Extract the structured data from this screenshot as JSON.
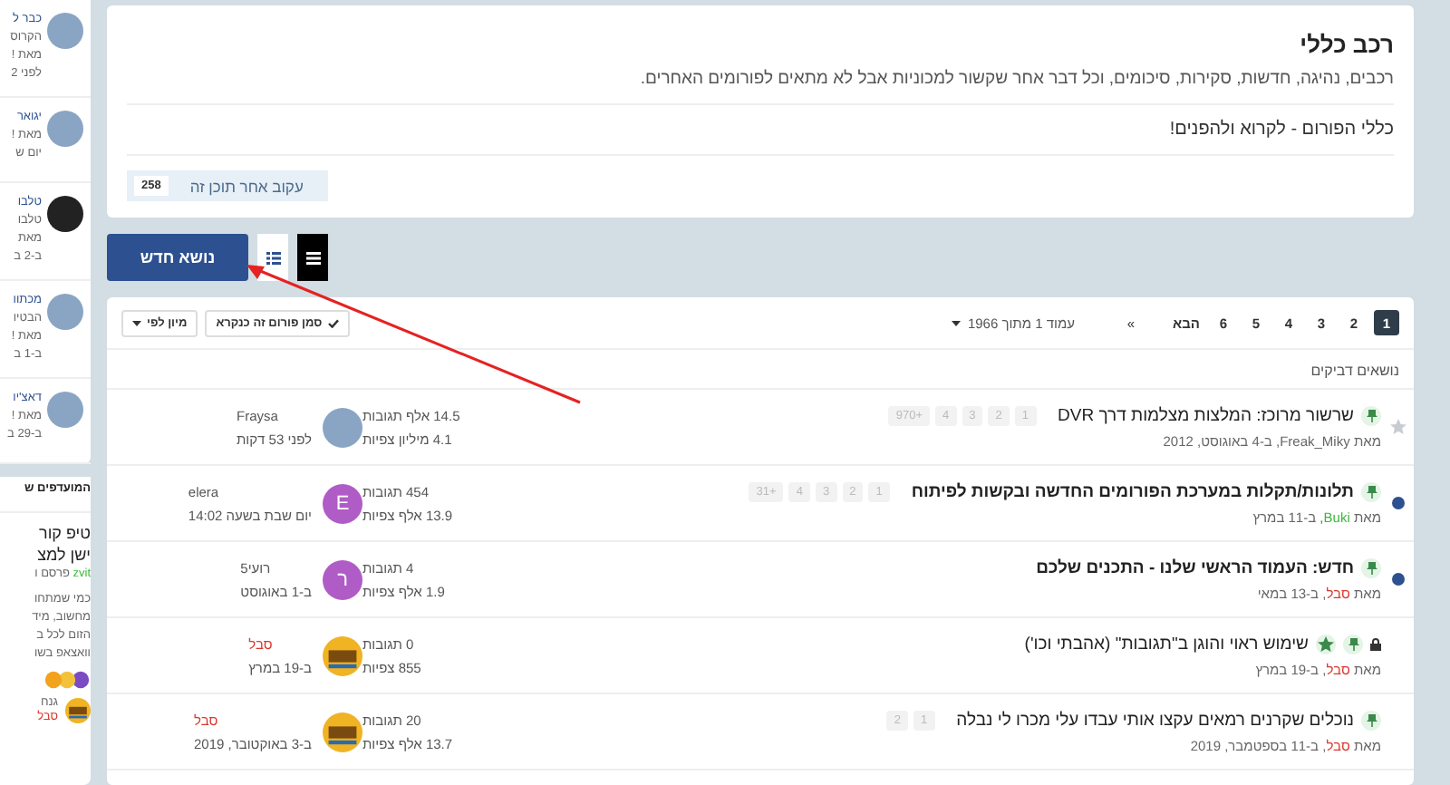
{
  "sidebar": {
    "items": [
      {
        "lines": [
          "כבר ל",
          "הקרוס",
          "מאת !",
          "לפני 2"
        ]
      },
      {
        "lines": [
          "יגואר",
          "מאת !",
          "יום ש"
        ]
      },
      {
        "lines": [
          "טלבו",
          "טלבו",
          "מאת",
          "ב-2 ב"
        ]
      },
      {
        "lines": [
          "מכתוו",
          "הבטיו",
          "מאת !",
          "ב-1 ב"
        ]
      },
      {
        "lines": [
          "דאצ'יו",
          "מאת !",
          "ב-29 ב"
        ]
      }
    ],
    "featured": {
      "heading": "המועדפים ש",
      "title_lines": [
        "טיפ קור",
        "ישן למצ"
      ],
      "byline_user": "zvit",
      "byline_rest": "פרסם ו",
      "body_lines": [
        "כמי שמתחו",
        "מחשוב, מיד",
        "הזום לכל ב",
        "וואצאפ בשו"
      ],
      "comment_user": "גנח",
      "comment_sub": "סבל"
    }
  },
  "forum": {
    "title": "רכב כללי",
    "description": "רכבים, נהיגה, חדשות, סקירות, סיכומים, וכל דבר אחר שקשור למכוניות אבל לא מתאים לפורומים האחרים.",
    "rules": "כללי הפורום - לקרוא ולהפנים!",
    "follow": {
      "label": "עקוב אחר תוכן זה",
      "count": "258"
    }
  },
  "new_topic": "נושא חדש",
  "views": [
    {
      "kind": "list",
      "selected": false
    },
    {
      "kind": "table",
      "selected": true
    }
  ],
  "pagination": {
    "pages": [
      {
        "label": "1",
        "selected": true
      },
      {
        "label": "2",
        "selected": false
      },
      {
        "label": "3",
        "selected": false
      },
      {
        "label": "4",
        "selected": false
      },
      {
        "label": "5",
        "selected": false
      },
      {
        "label": "6",
        "selected": false
      }
    ],
    "next": "הבא",
    "last": "»",
    "page_of": "עמוד 1 מתוך 1966"
  },
  "mark_read": "סמן פורום זה כנקרא",
  "sort": "מיון לפי",
  "sticky_heading": "נושאים דביקים",
  "topics": [
    {
      "marker": {
        "kind": "star"
      },
      "unread": false,
      "locked": false,
      "pinned": true,
      "featured": false,
      "title": "שרשור מרוכז: המלצות מצלמות דרך DVR",
      "pages": [
        "1",
        "2",
        "3",
        "4",
        "+970"
      ],
      "by": "מאת",
      "author": {
        "name": "Freak_Miky"
      },
      "date": ", ב-4 באוגוסט, 2012",
      "replies": "14.5 אלף תגובות",
      "views": "4.1 מיליון צפיות",
      "avatar": {
        "kind": "photo"
      },
      "last_user": {
        "name": "Fraysa"
      },
      "last_time": "לפני 53 דקות"
    },
    {
      "marker": {
        "kind": "dot"
      },
      "unread": true,
      "locked": false,
      "pinned": true,
      "featured": false,
      "title": "תלונות/תקלות במערכת הפורומים החדשה ובקשות לפיתוח",
      "pages": [
        "1",
        "2",
        "3",
        "4",
        "+31"
      ],
      "by": "מאת",
      "author": {
        "name": "Buki",
        "color": "#3bb83b"
      },
      "date": ", ב-11 במרץ",
      "replies": "454 תגובות",
      "views": "13.9 אלף צפיות",
      "avatar": {
        "kind": "letter",
        "letter": "E"
      },
      "last_user": {
        "name": "elera"
      },
      "last_time": "יום שבת בשעה 14:02"
    },
    {
      "marker": {
        "kind": "dot"
      },
      "unread": true,
      "locked": false,
      "pinned": true,
      "featured": false,
      "title": "חדש: העמוד הראשי שלנו - התכנים שלכם",
      "by": "מאת",
      "author": {
        "name": "סבל",
        "color": "#d9382f"
      },
      "date": ", ב-13 במאי",
      "replies": "4 תגובות",
      "views": "1.9 אלף צפיות",
      "avatar": {
        "kind": "letter",
        "letter": "ר"
      },
      "last_user": {
        "name": "רועי5"
      },
      "last_time": "ב-1 באוגוסט"
    },
    {
      "unread": false,
      "locked": true,
      "pinned": true,
      "featured": true,
      "title": "שימוש ראוי והוגן ב\"תגובות\" (אהבתי וכו')",
      "by": "מאת",
      "author": {
        "name": "סבל",
        "color": "#d9382f"
      },
      "date": ", ב-19 במרץ",
      "replies": "0 תגובות",
      "views": "855 צפיות",
      "avatar": {
        "kind": "logo"
      },
      "last_user": {
        "name": "סבל",
        "color": "#d9382f"
      },
      "last_time": "ב-19 במרץ"
    },
    {
      "unread": false,
      "locked": false,
      "pinned": true,
      "featured": false,
      "title": "נוכלים שקרנים רמאים עקצו אותי עבדו עלי מכרו לי נבלה",
      "pages": [
        "1",
        "2"
      ],
      "by": "מאת",
      "author": {
        "name": "סבל",
        "color": "#d9382f"
      },
      "date": ", ב-11 בספטמבר, 2019",
      "replies": "20 תגובות",
      "views": "13.7 אלף צפיות",
      "avatar": {
        "kind": "logo"
      },
      "last_user": {
        "name": "סבל",
        "color": "#d9382f"
      },
      "last_time": "ב-3 באוקטובר, 2019"
    }
  ]
}
